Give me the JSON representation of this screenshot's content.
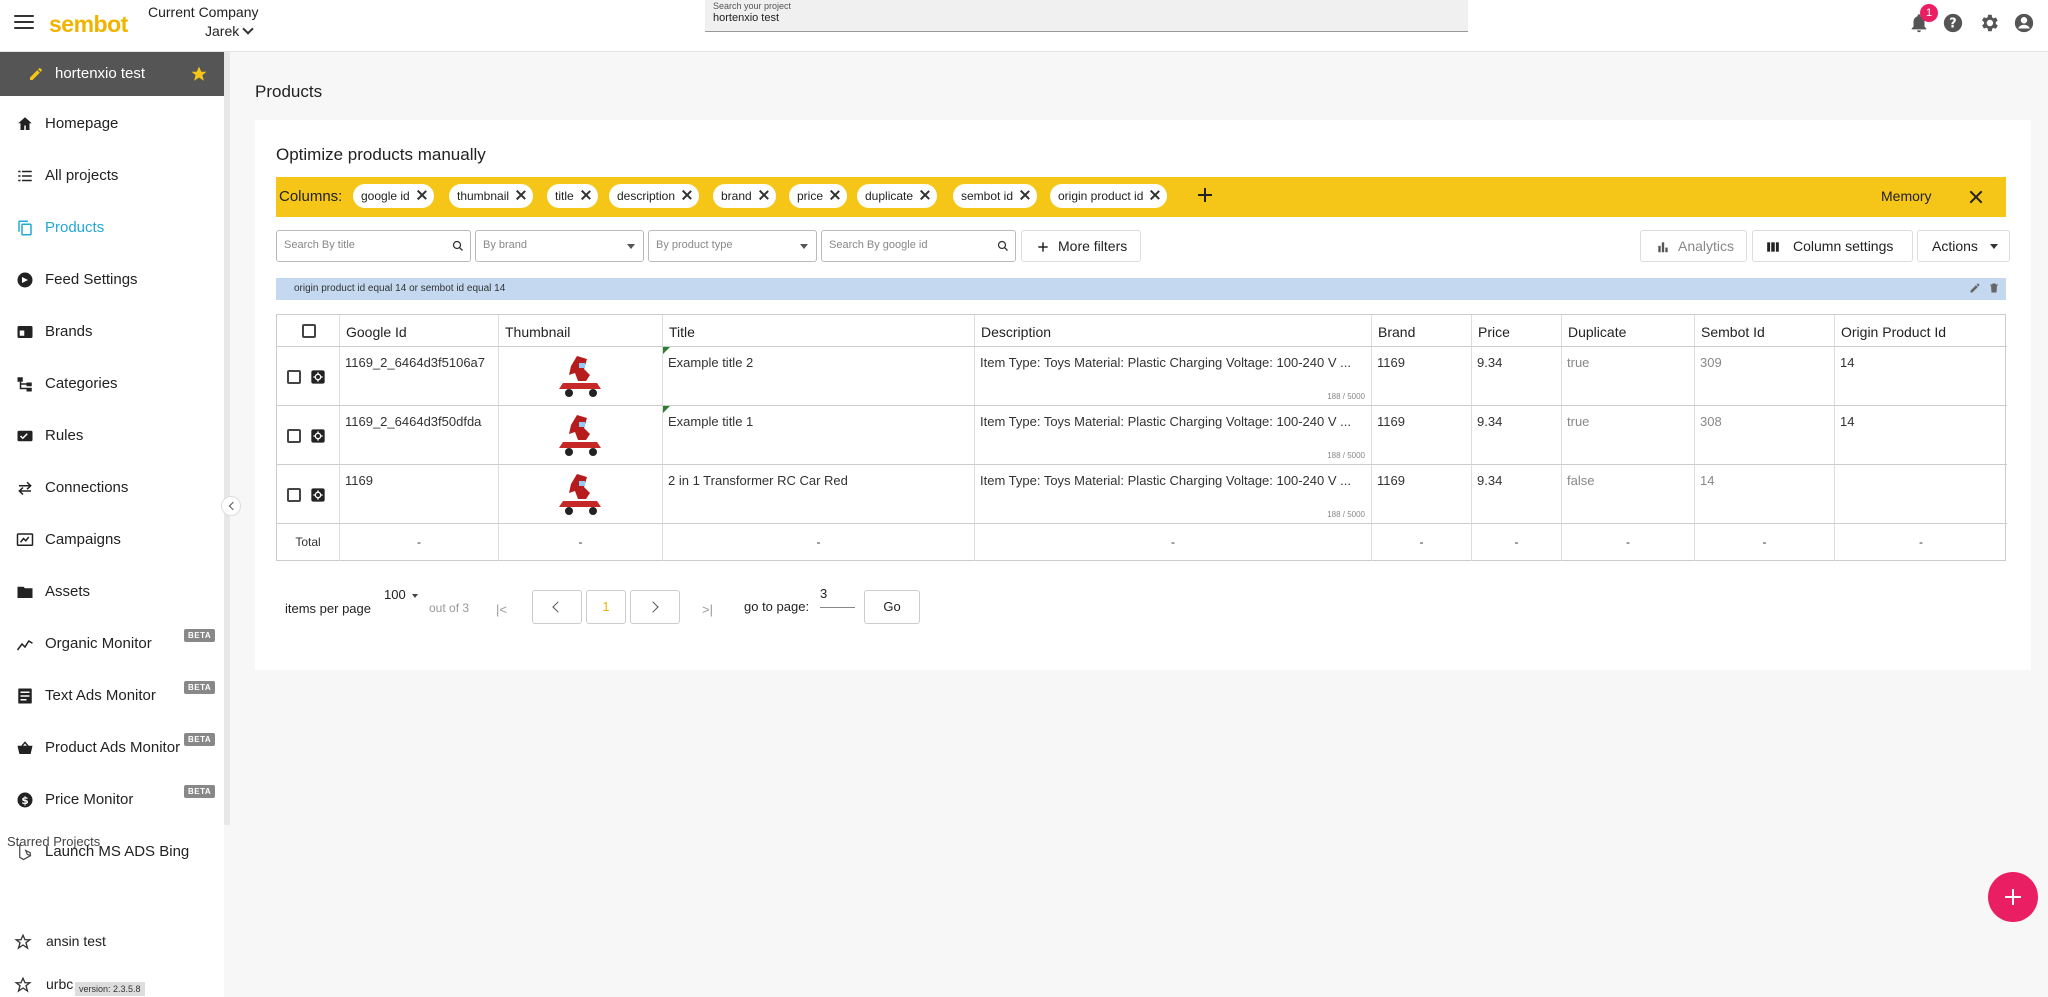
{
  "header": {
    "logo": "sembot",
    "company_label": "Current Company",
    "user": "Jarek",
    "search_label": "Search your project",
    "search_value": "hortenxio test",
    "notification_count": "1",
    "icons": [
      "menu-icon",
      "bell-icon",
      "help-icon",
      "gear-icon",
      "account-icon"
    ]
  },
  "sidebar": {
    "project_name": "hortenxio test",
    "items": [
      {
        "label": "Homepage",
        "icon": "home-icon"
      },
      {
        "label": "All projects",
        "icon": "list-icon"
      },
      {
        "label": "Products",
        "icon": "copy-icon",
        "active": true
      },
      {
        "label": "Feed Settings",
        "icon": "feed-icon"
      },
      {
        "label": "Brands",
        "icon": "brand-icon"
      },
      {
        "label": "Categories",
        "icon": "tree-icon"
      },
      {
        "label": "Rules",
        "icon": "rules-icon"
      },
      {
        "label": "Connections",
        "icon": "swap-icon"
      },
      {
        "label": "Campaigns",
        "icon": "campaign-icon"
      },
      {
        "label": "Assets",
        "icon": "folder-icon"
      },
      {
        "label": "Organic Monitor",
        "icon": "trend-icon",
        "badge": "BETA"
      },
      {
        "label": "Text Ads Monitor",
        "icon": "doc-icon",
        "badge": "BETA"
      },
      {
        "label": "Product Ads Monitor",
        "icon": "basket-icon",
        "badge": "BETA"
      },
      {
        "label": "Price Monitor",
        "icon": "dollar-icon",
        "badge": "BETA"
      },
      {
        "label": "Launch MS ADS Bing",
        "icon": "bing-icon"
      }
    ],
    "starred_title": "Starred Projects",
    "starred": [
      "ansin test",
      "urbc"
    ],
    "version": "version: 2.3.5.8"
  },
  "main": {
    "page_title": "Products",
    "card_title": "Optimize products manually",
    "columns_label": "Columns:",
    "column_chips": [
      "google id",
      "thumbnail",
      "title",
      "description",
      "brand",
      "price",
      "duplicate",
      "sembot id",
      "origin product id"
    ],
    "memory_label": "Memory",
    "filters": {
      "title_placeholder": "Search By title",
      "brand_placeholder": "By brand",
      "type_placeholder": "By product type",
      "google_placeholder": "Search By google id",
      "more_filters": "More filters"
    },
    "analytics_label": "Analytics",
    "column_settings_label": "Column settings",
    "actions_label": "Actions",
    "active_filter": "origin product id  equal  14   or  sembot id  equal  14",
    "table": {
      "headers": [
        "Google Id",
        "Thumbnail",
        "Title",
        "Description",
        "Brand",
        "Price",
        "Duplicate",
        "Sembot Id",
        "Origin Product Id"
      ],
      "rows": [
        {
          "google_id": "1169_2_6464d3f5106a7",
          "title": "Example title 2",
          "description": "Item Type: Toys Material: Plastic Charging Voltage: 100-240 V ...",
          "desc_count": "188 / 5000",
          "brand": "1169",
          "price": "9.34",
          "duplicate": "true",
          "sembot_id": "309",
          "origin_id": "14"
        },
        {
          "google_id": "1169_2_6464d3f50dfda",
          "title": "Example title 1",
          "description": "Item Type: Toys Material: Plastic Charging Voltage: 100-240 V ...",
          "desc_count": "188 / 5000",
          "brand": "1169",
          "price": "9.34",
          "duplicate": "true",
          "sembot_id": "308",
          "origin_id": "14"
        },
        {
          "google_id": "1169",
          "title": "2 in 1 Transformer RC Car Red",
          "description": "Item Type: Toys Material: Plastic Charging Voltage: 100-240 V ...",
          "desc_count": "188 / 5000",
          "brand": "1169",
          "price": "9.34",
          "duplicate": "false",
          "sembot_id": "14",
          "origin_id": ""
        }
      ],
      "total_label": "Total",
      "total_dash": "-"
    },
    "pagination": {
      "items_per_page_label": "items per page",
      "items_per_page": "100",
      "out_of": "out of 3",
      "current_page": "1",
      "go_to_label": "go to page:",
      "go_to_value": "3",
      "go_label": "Go"
    }
  }
}
